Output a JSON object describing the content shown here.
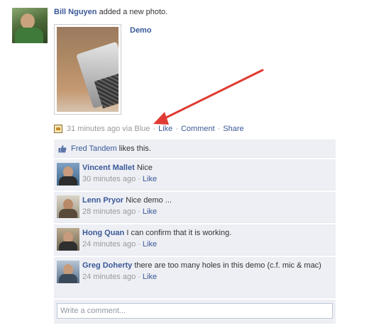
{
  "story": {
    "actor": "Bill Nguyen",
    "action": "added a new photo.",
    "photo_title": "Demo"
  },
  "meta": {
    "time": "31 minutes ago via Blue",
    "sep": "·",
    "like": "Like",
    "comment": "Comment",
    "share": "Share"
  },
  "likes": {
    "liker": "Fred Tandem",
    "text": "likes this."
  },
  "comments": [
    {
      "author": "Vincent Mallet",
      "text": "Nice",
      "time": "30 minutes ago",
      "sep": "·",
      "like": "Like"
    },
    {
      "author": "Lenn Pryor",
      "text": "Nice demo ...",
      "time": "28 minutes ago",
      "sep": "·",
      "like": "Like"
    },
    {
      "author": "Hong Quan",
      "text": "I can confirm that it is working.",
      "time": "24 minutes ago",
      "sep": "·",
      "like": "Like"
    },
    {
      "author": "Greg Doherty",
      "text": "there are too many holes in this demo (c.f. mic & mac)",
      "time": "24 minutes ago",
      "sep": "·",
      "like": "Like"
    }
  ],
  "composer": {
    "placeholder": "Write a comment..."
  },
  "colors": {
    "link": "#3b5998",
    "ufi_bg": "#edeff4",
    "muted": "#999999",
    "arrow": "#e03b32"
  },
  "icons": {
    "meta": "photo-app-icon",
    "likes": "thumbs-up-icon"
  }
}
